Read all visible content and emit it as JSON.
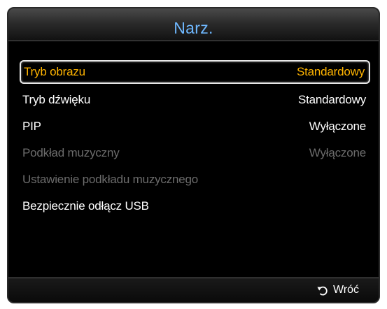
{
  "panel": {
    "title": "Narz."
  },
  "menu": {
    "items": [
      {
        "label": "Tryb obrazu",
        "value": "Standardowy",
        "state": "selected"
      },
      {
        "label": "Tryb dźwięku",
        "value": "Standardowy",
        "state": "normal"
      },
      {
        "label": "PIP",
        "value": "Wyłączone",
        "state": "normal"
      },
      {
        "label": "Podkład muzyczny",
        "value": "Wyłączone",
        "state": "disabled"
      },
      {
        "label": "Ustawienie podkładu muzycznego",
        "value": "",
        "state": "disabled"
      },
      {
        "label": "Bezpiecznie odłącz USB",
        "value": "",
        "state": "normal"
      }
    ]
  },
  "footer": {
    "back_label": "Wróć",
    "back_icon": "return-arrow-icon"
  },
  "colors": {
    "title": "#6fb8ff",
    "selected_text": "#ffb400",
    "disabled_text": "#6c6c6c",
    "normal_text": "#ffffff"
  }
}
